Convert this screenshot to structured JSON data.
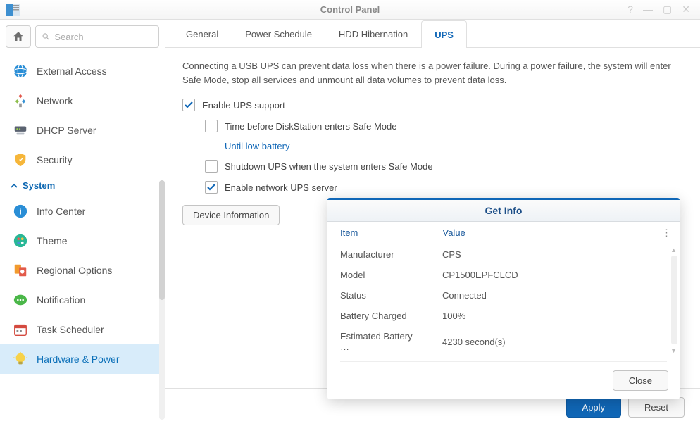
{
  "window": {
    "title": "Control Panel"
  },
  "search": {
    "placeholder": "Search"
  },
  "sidebar": {
    "group_label": "System",
    "items": [
      {
        "label": "External Access"
      },
      {
        "label": "Network"
      },
      {
        "label": "DHCP Server"
      },
      {
        "label": "Security"
      },
      {
        "label": "Info Center"
      },
      {
        "label": "Theme"
      },
      {
        "label": "Regional Options"
      },
      {
        "label": "Notification"
      },
      {
        "label": "Task Scheduler"
      },
      {
        "label": "Hardware & Power"
      }
    ]
  },
  "tabs": [
    {
      "label": "General"
    },
    {
      "label": "Power Schedule"
    },
    {
      "label": "HDD Hibernation"
    },
    {
      "label": "UPS"
    }
  ],
  "main": {
    "intro": "Connecting a USB UPS can prevent data loss when there is a power failure. During a power failure, the system will enter Safe Mode, stop all services and unmount all data volumes to prevent data loss.",
    "enable_label": "Enable UPS support",
    "time_label": "Time before DiskStation enters Safe Mode",
    "until_low": "Until low battery",
    "shutdown_label": "Shutdown UPS when the system enters Safe Mode",
    "network_label": "Enable network UPS server",
    "device_info_btn": "Device Information"
  },
  "modal": {
    "title": "Get Info",
    "col_item": "Item",
    "col_value": "Value",
    "rows": [
      {
        "item": "Manufacturer",
        "value": "CPS"
      },
      {
        "item": "Model",
        "value": "CP1500EPFCLCD"
      },
      {
        "item": "Status",
        "value": "Connected"
      },
      {
        "item": "Battery Charged",
        "value": "100%"
      },
      {
        "item": "Estimated Battery …",
        "value": "4230 second(s)"
      }
    ],
    "close": "Close"
  },
  "footer": {
    "apply": "Apply",
    "reset": "Reset"
  }
}
